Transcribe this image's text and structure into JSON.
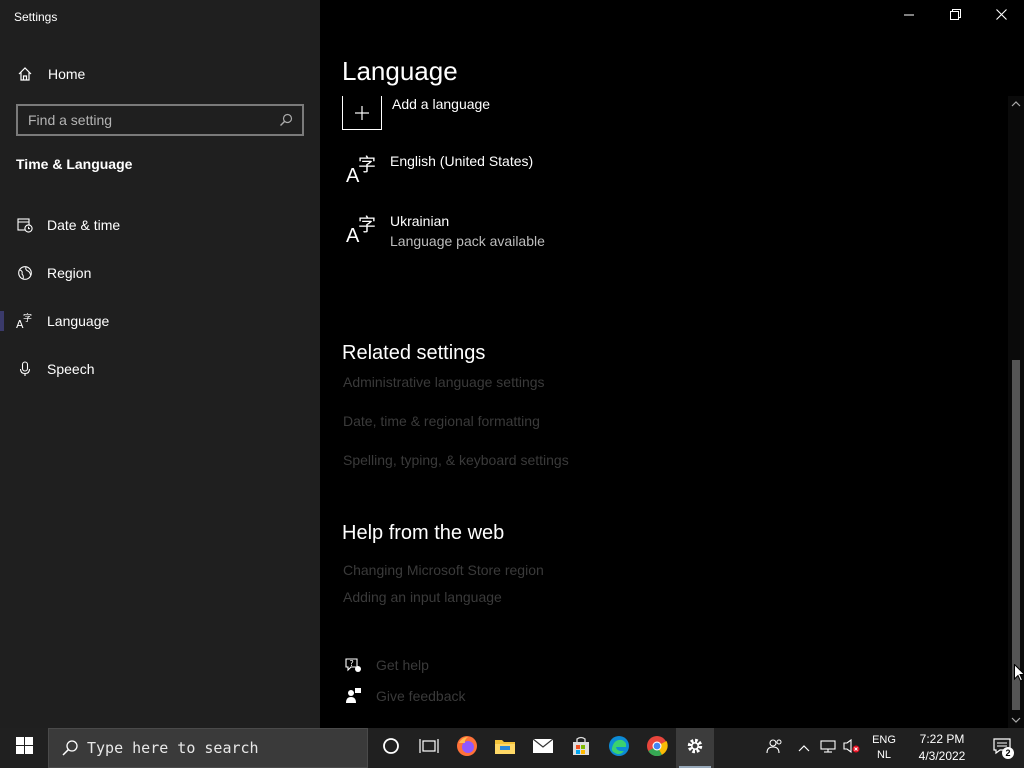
{
  "window": {
    "title": "Settings"
  },
  "sidebar": {
    "home_label": "Home",
    "search_placeholder": "Find a setting",
    "section_heading": "Time & Language",
    "items": [
      {
        "label": "Date & time",
        "icon": "date-time-icon"
      },
      {
        "label": "Region",
        "icon": "globe-icon"
      },
      {
        "label": "Language",
        "icon": "language-icon",
        "selected": true
      },
      {
        "label": "Speech",
        "icon": "microphone-icon"
      }
    ]
  },
  "main": {
    "title": "Language",
    "add_language_label": "Add a language",
    "languages": [
      {
        "name": "English (United States)",
        "status": ""
      },
      {
        "name": "Ukrainian",
        "status": "Language pack available"
      }
    ],
    "related_heading": "Related settings",
    "related_links": [
      "Administrative language settings",
      "Date, time & regional formatting",
      "Spelling, typing, & keyboard settings"
    ],
    "help_heading": "Help from the web",
    "help_links": [
      "Changing Microsoft Store region",
      "Adding an input language"
    ],
    "get_help_label": "Get help",
    "give_feedback_label": "Give feedback"
  },
  "taskbar": {
    "search_text": "Type here to search",
    "apps": [
      "cortana-icon",
      "task-view-icon",
      "firefox-icon",
      "file-explorer-icon",
      "mail-icon",
      "store-icon",
      "edge-icon",
      "chrome-icon",
      "settings-icon"
    ],
    "language_top": "ENG",
    "language_bottom": "NL",
    "time": "7:22 PM",
    "date": "4/3/2022",
    "notification_count": "2"
  }
}
